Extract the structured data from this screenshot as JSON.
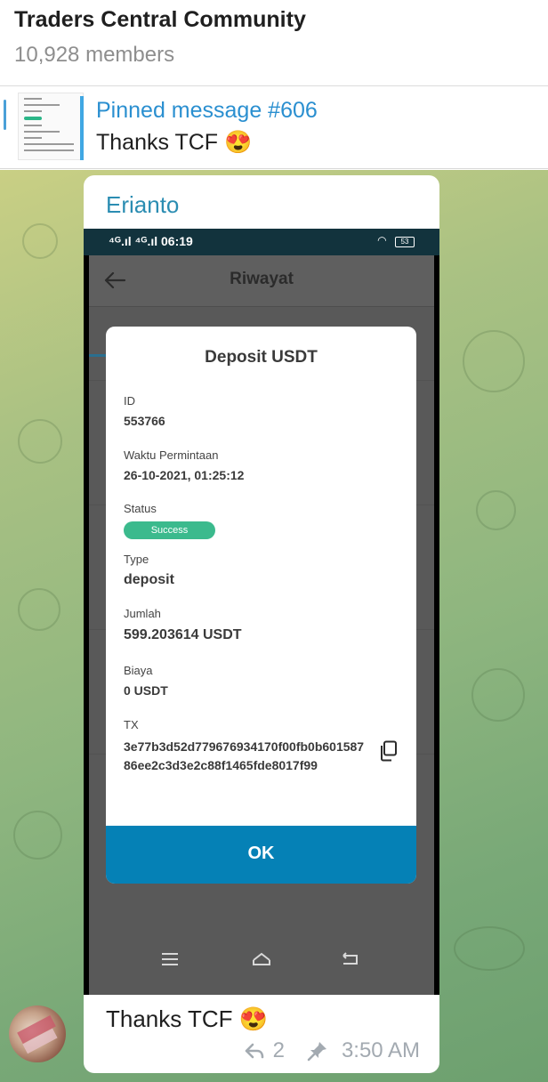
{
  "header": {
    "title": "Traders Central Community",
    "members": "10,928 members"
  },
  "pinned": {
    "title": "Pinned message #606",
    "text": "Thanks TCF 😍"
  },
  "message": {
    "sender": "Erianto",
    "caption": "Thanks TCF 😍",
    "replies": "2",
    "time": "3:50 AM"
  },
  "phone": {
    "status_left": "⁴ᴳ.ıl ⁴ᴳ.ıl 06:19",
    "battery": "53",
    "screen_title": "Riwayat",
    "dialog": {
      "title": "Deposit USDT",
      "id_label": "ID",
      "id_value": "553766",
      "time_label": "Waktu Permintaan",
      "time_value": "26-10-2021, 01:25:12",
      "status_label": "Status",
      "status_value": "Success",
      "type_label": "Type",
      "type_value": "deposit",
      "amount_label": "Jumlah",
      "amount_value": "599.203614 USDT",
      "fee_label": "Biaya",
      "fee_value": "0 USDT",
      "tx_label": "TX",
      "tx_value": "3e77b3d52d779676934170f00fb0b60158786ee2c3d3e2c88f1465fde8017f99",
      "ok_label": "OK"
    }
  },
  "colors": {
    "link_blue": "#2a8fd0",
    "sender": "#2b8db2",
    "success": "#3bba8d",
    "ok_bar": "#0581b6"
  }
}
